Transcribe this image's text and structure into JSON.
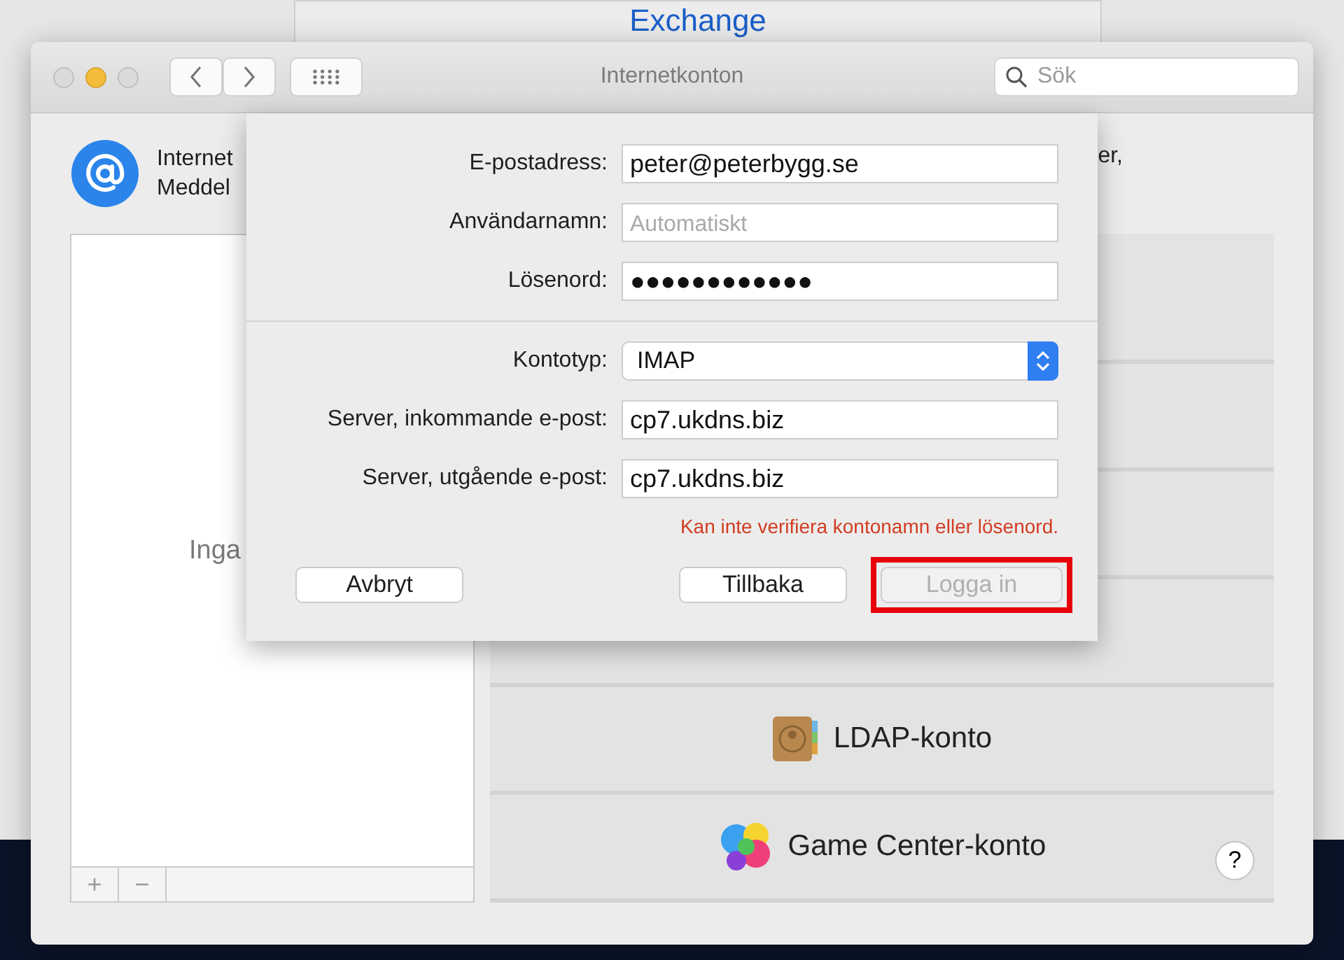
{
  "background_window": {
    "title": "Exchange"
  },
  "window": {
    "title": "Internetkonton",
    "search": {
      "placeholder": "Sök"
    }
  },
  "header": {
    "text_left": [
      "Internet",
      "Meddel"
    ],
    "text_right": "er,"
  },
  "accounts_list": {
    "empty_text": "Inga",
    "buttons": [
      "+",
      "−"
    ]
  },
  "providers": [
    {
      "label": "LDAP-konto",
      "kind": "ldap"
    },
    {
      "label": "Game Center-konto",
      "kind": "gamecenter"
    }
  ],
  "help": "?",
  "sheet": {
    "fields": [
      {
        "label": "E-postadress:",
        "kind": "text",
        "value": "peter@peterbygg.se"
      },
      {
        "label": "Användarnamn:",
        "kind": "text",
        "placeholder": "Automatiskt"
      },
      {
        "label": "Lösenord:",
        "kind": "text",
        "value": "●●●●●●●●●●●●"
      }
    ],
    "server_fields": [
      {
        "label": "Kontotyp:",
        "kind": "select",
        "value": "IMAP"
      },
      {
        "label": "Server, inkommande e-post:",
        "kind": "text",
        "value": "cp7.ukdns.biz"
      },
      {
        "label": "Server, utgående e-post:",
        "kind": "text",
        "value": "cp7.ukdns.biz"
      }
    ],
    "error": "Kan inte verifiera kontonamn eller lösenord.",
    "buttons": [
      {
        "label": "Avbryt",
        "disabled": false,
        "highlighted": false
      },
      {
        "label": "Tillbaka",
        "disabled": false,
        "highlighted": false
      },
      {
        "label": "Logga in",
        "disabled": true,
        "highlighted": true
      }
    ]
  }
}
